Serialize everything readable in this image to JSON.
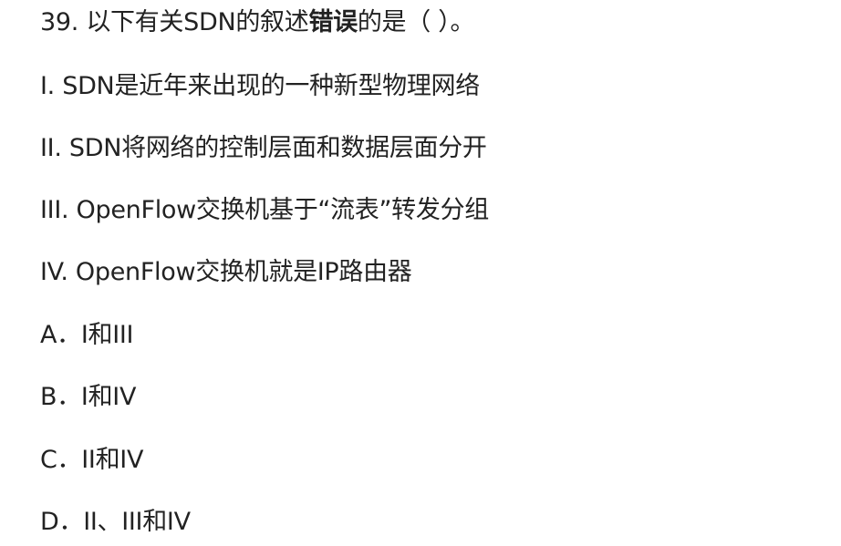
{
  "question": {
    "stem_before": "39. 以下有关SDN的叙述",
    "stem_emphasis": "错误",
    "stem_after": "的是（  ）。",
    "statements": [
      "I.  SDN是近年来出现的一种新型物理网络",
      "II.  SDN将网络的控制层面和数据层面分开",
      "III.  OpenFlow交换机基于“流表”转发分组",
      "IV.  OpenFlow交换机就是IP路由器"
    ],
    "options": [
      "A．I和III",
      "B．I和IV",
      "C．II和IV",
      "D．II、III和IV"
    ]
  }
}
